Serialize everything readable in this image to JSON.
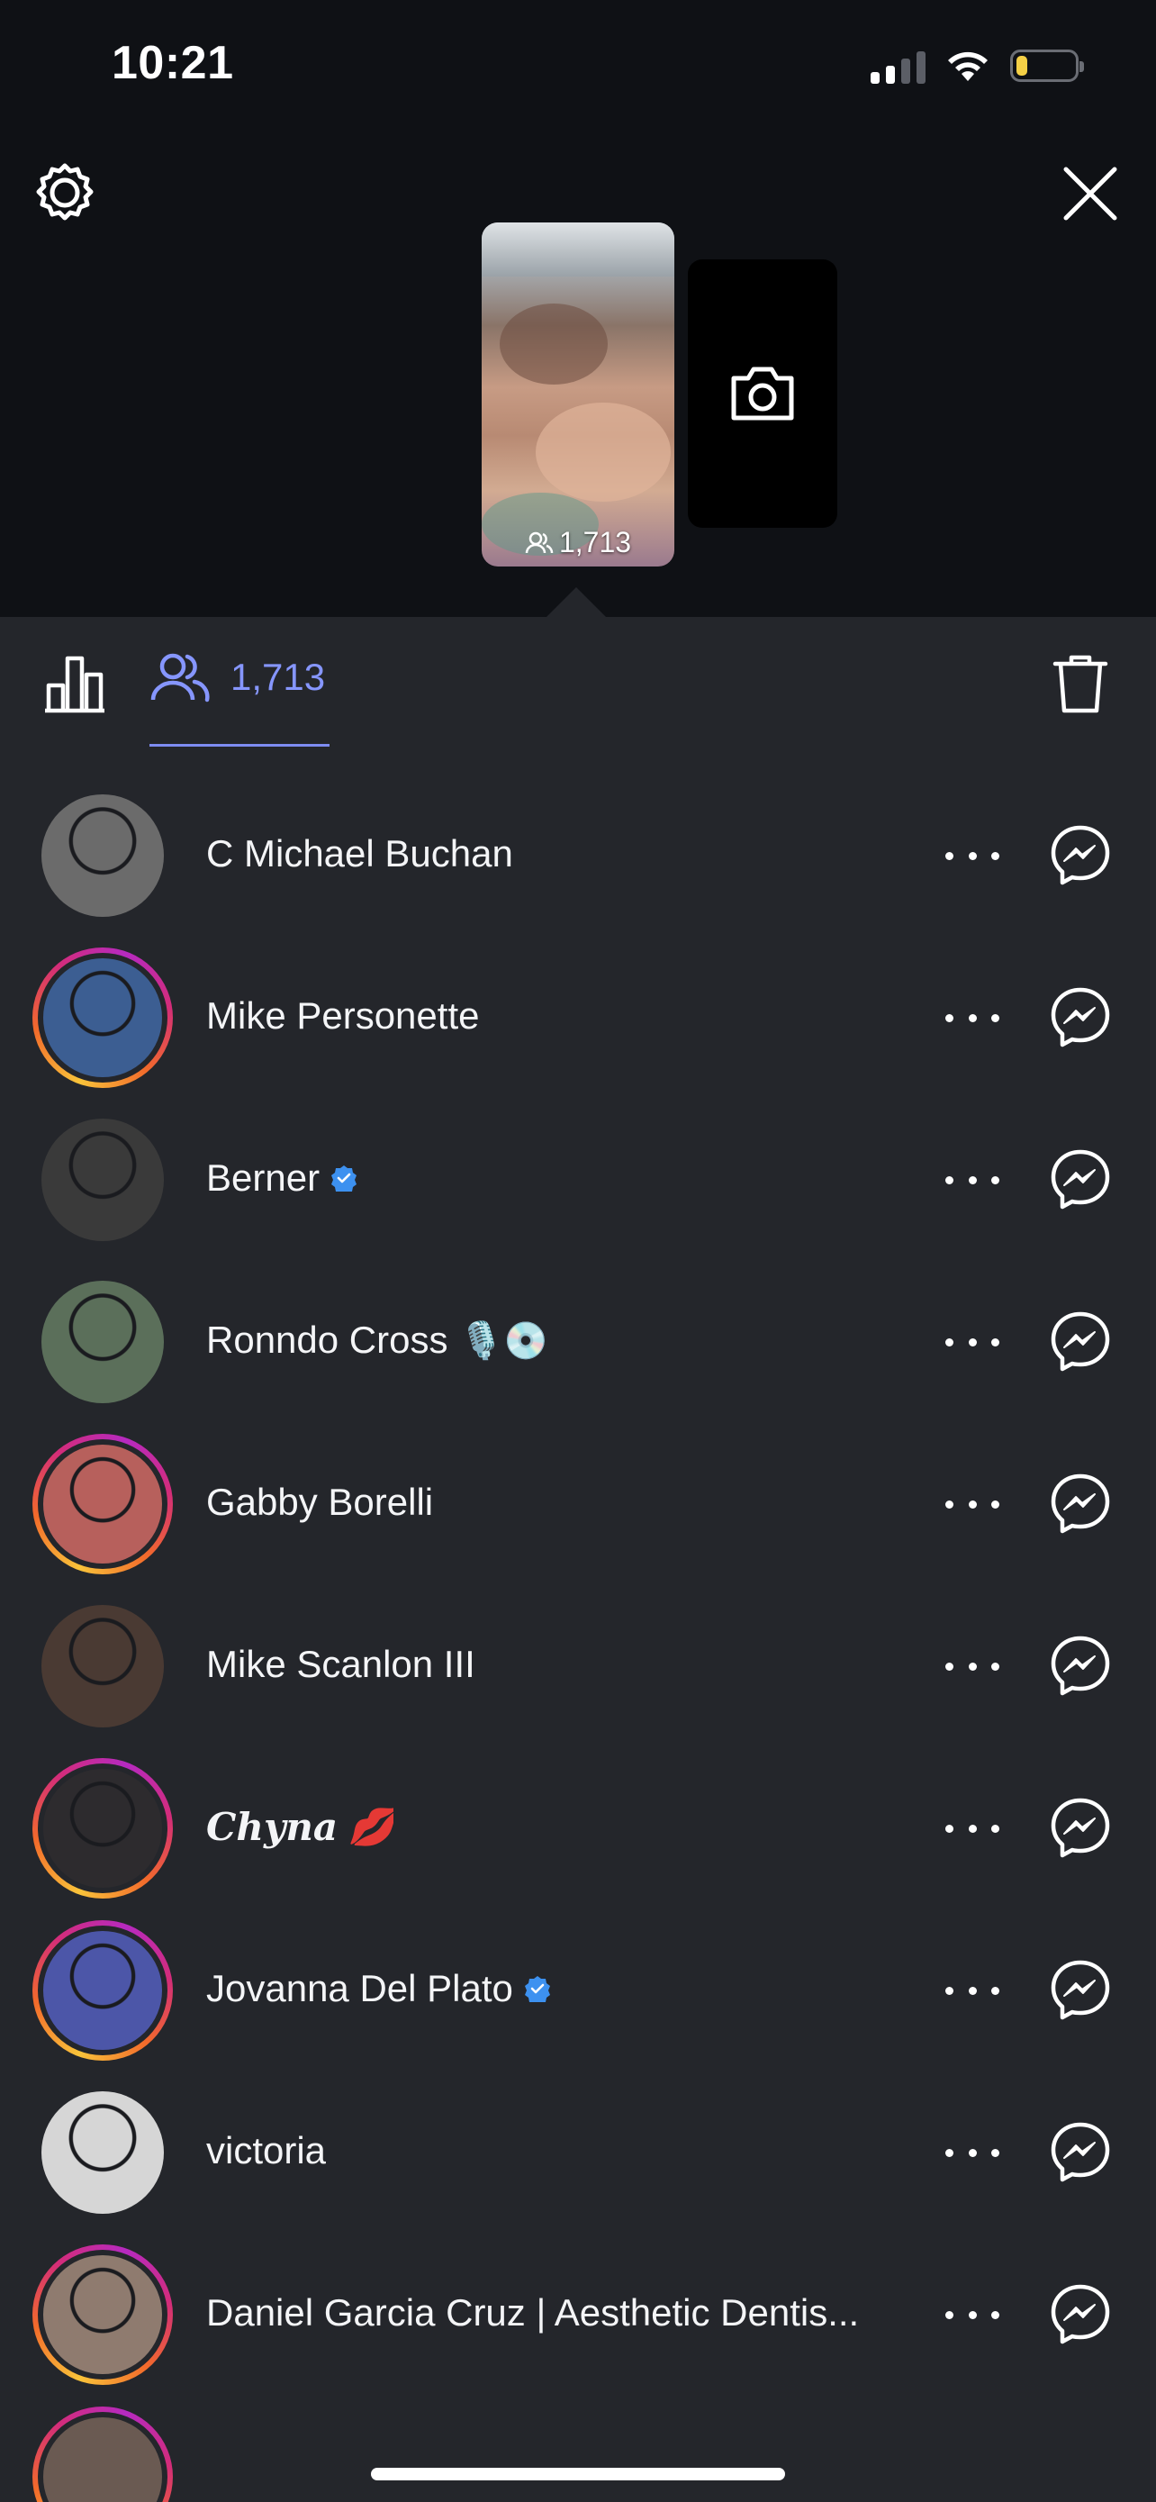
{
  "status_bar": {
    "time": "10:21"
  },
  "story": {
    "viewer_count": "1,713"
  },
  "tabs": {
    "viewers_count": "1,713"
  },
  "viewers": [
    {
      "name": "C Michael Buchan",
      "story_ring": false,
      "verified": false,
      "emoji": "",
      "italic": false,
      "avatar_color": "#6b6b6b"
    },
    {
      "name": "Mike Personette",
      "story_ring": true,
      "verified": false,
      "emoji": "",
      "italic": false,
      "avatar_color": "#3c5e92"
    },
    {
      "name": "Berner",
      "story_ring": false,
      "verified": true,
      "emoji": "",
      "italic": false,
      "avatar_color": "#3a3a3a"
    },
    {
      "name": "Ronndo Cross",
      "story_ring": false,
      "verified": false,
      "emoji": "🎙️💿",
      "italic": false,
      "avatar_color": "#5b6f5a"
    },
    {
      "name": "Gabby Borelli",
      "story_ring": true,
      "verified": false,
      "emoji": "",
      "italic": false,
      "avatar_color": "#b7605c"
    },
    {
      "name": "Mike Scanlon III",
      "story_ring": false,
      "verified": false,
      "emoji": "",
      "italic": false,
      "avatar_color": "#4a3a33"
    },
    {
      "name": "Chyna",
      "story_ring": true,
      "verified": false,
      "emoji": "💋",
      "italic": true,
      "avatar_color": "#2d2b2e"
    },
    {
      "name": "Jovanna Del Plato",
      "story_ring": true,
      "verified": true,
      "emoji": "",
      "italic": false,
      "avatar_color": "#4c56a8"
    },
    {
      "name": "victoria",
      "story_ring": false,
      "verified": false,
      "emoji": "",
      "italic": false,
      "avatar_color": "#d6d6d6"
    },
    {
      "name": "Daniel Garcia Cruz | Aesthetic Dentis...",
      "story_ring": true,
      "verified": false,
      "emoji": "",
      "italic": false,
      "avatar_color": "#8f7b6f"
    }
  ],
  "colors": {
    "accent": "#8696ff",
    "sheet_bg": "#24262b",
    "top_bg": "#0f1115",
    "verified": "#3d91f0"
  }
}
